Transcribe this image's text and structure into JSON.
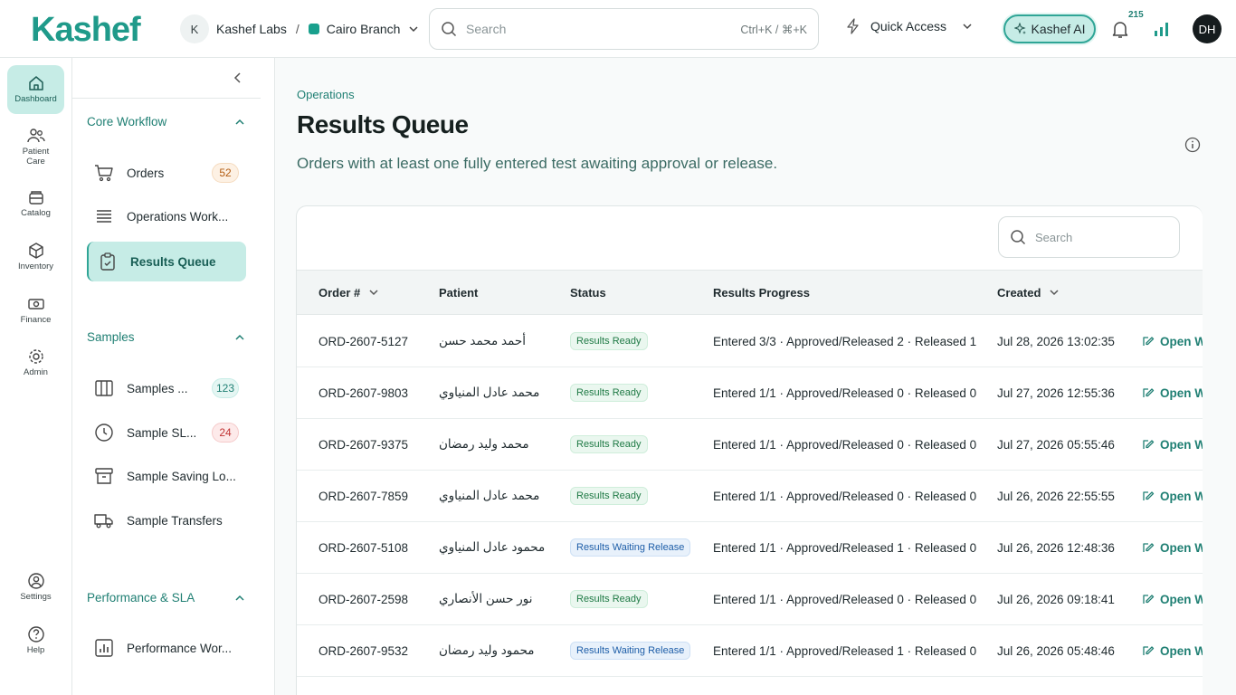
{
  "topbar": {
    "logo": "Kashef",
    "org_initial": "K",
    "org_name": "Kashef Labs",
    "separator": "/",
    "branch": "Cairo Branch",
    "search_placeholder": "Search",
    "search_shortcut": "Ctrl+K / ⌘+K",
    "quick_access": "Quick Access",
    "ai_label": "Kashef AI",
    "notification_count": "215",
    "user_initials": "DH"
  },
  "rail": [
    {
      "label": "Dashboard",
      "icon": "home-icon"
    },
    {
      "label": "Patient Care",
      "icon": "users-icon"
    },
    {
      "label": "Catalog",
      "icon": "catalog-icon"
    },
    {
      "label": "Inventory",
      "icon": "box-icon"
    },
    {
      "label": "Finance",
      "icon": "money-icon"
    },
    {
      "label": "Admin",
      "icon": "gear-icon"
    },
    {
      "label": "Settings",
      "icon": "user-circle-icon"
    },
    {
      "label": "Help",
      "icon": "help-icon"
    }
  ],
  "sidebar": {
    "sections": [
      {
        "title": "Core Workflow"
      },
      {
        "title": "Samples"
      },
      {
        "title": "Performance & SLA"
      }
    ],
    "items": [
      {
        "label": "Orders",
        "badge": "52",
        "icon": "cart-icon"
      },
      {
        "label": "Operations Work...",
        "badge": "",
        "icon": "list-icon"
      },
      {
        "label": "Results Queue",
        "badge": "",
        "icon": "clipboard-check-icon"
      },
      {
        "label": "Samples ...",
        "badge": "123",
        "icon": "columns-icon"
      },
      {
        "label": "Sample SL...",
        "badge": "24",
        "icon": "clock-icon"
      },
      {
        "label": "Sample Saving Lo...",
        "badge": "",
        "icon": "archive-icon"
      },
      {
        "label": "Sample Transfers",
        "badge": "",
        "icon": "truck-icon"
      },
      {
        "label": "Performance Wor...",
        "badge": "",
        "icon": "chart-icon"
      }
    ]
  },
  "page": {
    "breadcrumb": "Operations",
    "title": "Results Queue",
    "subtitle": "Orders with at least one fully entered test awaiting approval or release."
  },
  "table": {
    "search_placeholder": "Search",
    "columns": [
      "Order #",
      "Patient",
      "Status",
      "Results Progress",
      "Created"
    ],
    "open_label": "Open W",
    "rows": [
      {
        "order": "ORD-2607-5127",
        "patient": "أحمد محمد حسن",
        "status": "Results Ready",
        "status_type": "ready",
        "progress": "Entered 3/3 · Approved/Released 2 · Released 1",
        "created": "Jul 28, 2026 13:02:35"
      },
      {
        "order": "ORD-2607-9803",
        "patient": "محمد عادل المنياوي",
        "status": "Results Ready",
        "status_type": "ready",
        "progress": "Entered 1/1 · Approved/Released 0 · Released 0",
        "created": "Jul 27, 2026 12:55:36"
      },
      {
        "order": "ORD-2607-9375",
        "patient": "محمد وليد رمضان",
        "status": "Results Ready",
        "status_type": "ready",
        "progress": "Entered 1/1 · Approved/Released 0 · Released 0",
        "created": "Jul 27, 2026 05:55:46"
      },
      {
        "order": "ORD-2607-7859",
        "patient": "محمد عادل المنياوي",
        "status": "Results Ready",
        "status_type": "ready",
        "progress": "Entered 1/1 · Approved/Released 0 · Released 0",
        "created": "Jul 26, 2026 22:55:55"
      },
      {
        "order": "ORD-2607-5108",
        "patient": "محمود عادل المنياوي",
        "status": "Results Waiting Release",
        "status_type": "waiting",
        "progress": "Entered 1/1 · Approved/Released 1 · Released 0",
        "created": "Jul 26, 2026 12:48:36"
      },
      {
        "order": "ORD-2607-2598",
        "patient": "نور حسن الأنصاري",
        "status": "Results Ready",
        "status_type": "ready",
        "progress": "Entered 1/1 · Approved/Released 0 · Released 0",
        "created": "Jul 26, 2026 09:18:41"
      },
      {
        "order": "ORD-2607-9532",
        "patient": "محمود وليد رمضان",
        "status": "Results Waiting Release",
        "status_type": "waiting",
        "progress": "Entered 1/1 · Approved/Released 1 · Released 0",
        "created": "Jul 26, 2026 05:48:46"
      }
    ]
  },
  "colors": {
    "accent": "#1f9a8a",
    "accent_light": "#c6ece6",
    "ready_text": "#1f7a45",
    "waiting_text": "#1e5ea8"
  }
}
